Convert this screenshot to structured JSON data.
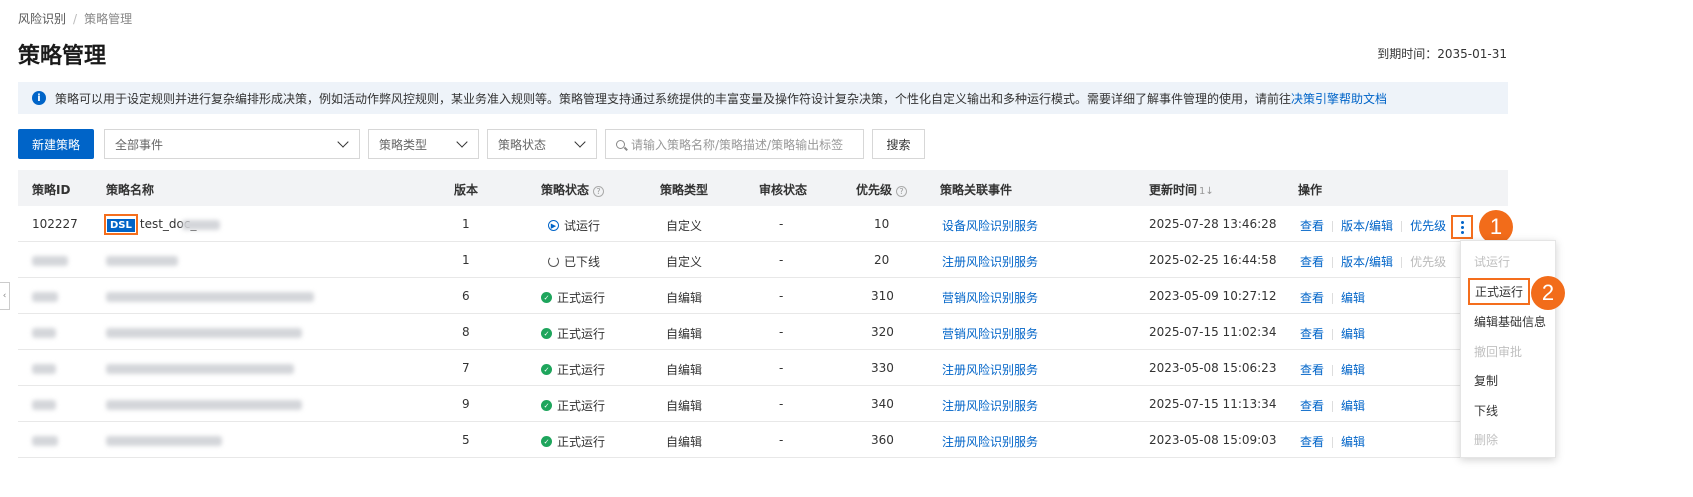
{
  "breadcrumb": {
    "root": "风险识别",
    "current": "策略管理"
  },
  "page_title": "策略管理",
  "expiry": "到期时间：2035-01-31",
  "notice": {
    "text": "策略可以用于设定规则并进行复杂编排形成决策，例如活动作弊风控规则，某业务准入规则等。策略管理支持通过系统提供的丰富变量及操作符设计复杂决策，个性化自定义输出和多种运行模式。需要详细了解事件管理的使用，请前往",
    "link": "决策引擎帮助文档"
  },
  "toolbar": {
    "new_button": "新建策略",
    "event_select": "全部事件",
    "type_select": "策略类型",
    "status_select": "策略状态",
    "search_placeholder": "请输入策略名称/策略描述/策略输出标签",
    "search_button": "搜索"
  },
  "columns": {
    "id": "策略ID",
    "name": "策略名称",
    "version": "版本",
    "status": "策略状态",
    "type": "策略类型",
    "review": "审核状态",
    "priority": "优先级",
    "event": "策略关联事件",
    "updated": "更新时间",
    "ops": "操作"
  },
  "rows": [
    {
      "id": "102227",
      "dsl": "DSL",
      "name": "test_doc_",
      "version": "1",
      "status": "试运行",
      "type": "自定义",
      "review": "-",
      "priority": "10",
      "event": "设备风险识别服务",
      "updated": "2025-07-28 13:46:28"
    },
    {
      "id": "",
      "dsl": "",
      "name": "",
      "version": "1",
      "status": "已下线",
      "type": "自定义",
      "review": "-",
      "priority": "20",
      "event": "注册风险识别服务",
      "updated": "2025-02-25 16:44:58"
    },
    {
      "id": "",
      "dsl": "",
      "name": "",
      "version": "6",
      "status": "正式运行",
      "type": "自编辑",
      "review": "-",
      "priority": "310",
      "event": "营销风险识别服务",
      "updated": "2023-05-09 10:27:12"
    },
    {
      "id": "",
      "dsl": "",
      "name": "",
      "version": "8",
      "status": "正式运行",
      "type": "自编辑",
      "review": "-",
      "priority": "320",
      "event": "营销风险识别服务",
      "updated": "2025-07-15 11:02:34"
    },
    {
      "id": "",
      "dsl": "",
      "name": "",
      "version": "7",
      "status": "正式运行",
      "type": "自编辑",
      "review": "-",
      "priority": "330",
      "event": "注册风险识别服务",
      "updated": "2023-05-08 15:06:23"
    },
    {
      "id": "",
      "dsl": "",
      "name": "",
      "version": "9",
      "status": "正式运行",
      "type": "自编辑",
      "review": "-",
      "priority": "340",
      "event": "注册风险识别服务",
      "updated": "2025-07-15 11:13:34"
    },
    {
      "id": "",
      "dsl": "",
      "name": "",
      "version": "5",
      "status": "正式运行",
      "type": "自编辑",
      "review": "-",
      "priority": "360",
      "event": "注册风险识别服务",
      "updated": "2023-05-08 15:09:03"
    }
  ],
  "ops": {
    "view": "查看",
    "version_edit": "版本/编辑",
    "priority": "优先级",
    "edit": "编辑"
  },
  "menu": {
    "items": [
      "试运行",
      "正式运行",
      "编辑基础信息",
      "撤回审批",
      "复制",
      "下线",
      "删除"
    ]
  },
  "callouts": [
    "1",
    "2"
  ],
  "colors": {
    "primary": "#0064c8",
    "highlight": "#f46e1d",
    "success": "#1ea55c"
  },
  "icons": [
    "info-icon",
    "chevron-down-icon",
    "search-icon",
    "help-icon",
    "sort-icon",
    "play-icon",
    "power-icon",
    "check-circle-icon",
    "more-vertical-icon"
  ]
}
